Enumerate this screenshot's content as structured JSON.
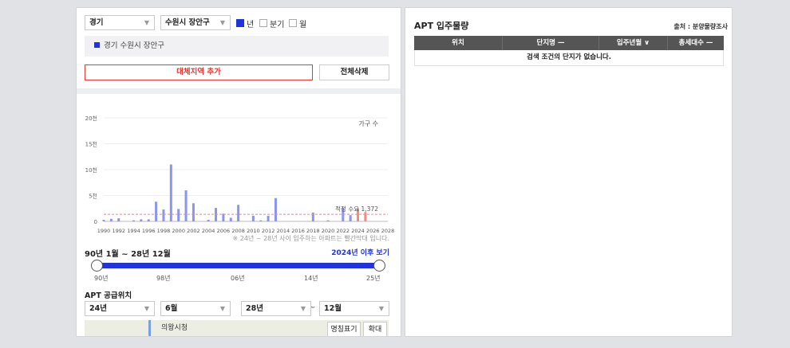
{
  "filters": {
    "province": "경기",
    "district": "수원시 장안구",
    "period_types": [
      {
        "label": "년",
        "checked": true
      },
      {
        "label": "분기",
        "checked": false
      },
      {
        "label": "월",
        "checked": false
      }
    ]
  },
  "selected_region": "경기 수원시 장안구",
  "buttons": {
    "add_region": "대체지역 추가",
    "delete_all": "전체삭제"
  },
  "chart_data": {
    "type": "bar",
    "y_unit_label": "가구 수",
    "ylim": [
      0,
      20000
    ],
    "y_ticks": [
      "0",
      "5천",
      "10천",
      "15천",
      "20천"
    ],
    "x_ticks": [
      "1990",
      "1992",
      "1994",
      "1996",
      "1998",
      "2000",
      "2002",
      "2004",
      "2006",
      "2008",
      "2010",
      "2012",
      "2014",
      "2016",
      "2018",
      "2020",
      "2022",
      "2024",
      "2026",
      "2028"
    ],
    "categories": [
      1990,
      1991,
      1992,
      1993,
      1994,
      1995,
      1996,
      1997,
      1998,
      1999,
      2000,
      2001,
      2002,
      2003,
      2004,
      2005,
      2006,
      2007,
      2008,
      2009,
      2010,
      2011,
      2012,
      2013,
      2014,
      2015,
      2016,
      2017,
      2018,
      2019,
      2020,
      2021,
      2022,
      2023,
      2024,
      2025,
      2026,
      2027,
      2028
    ],
    "values": [
      300,
      500,
      600,
      0,
      200,
      400,
      400,
      3800,
      2300,
      11000,
      2400,
      6000,
      3500,
      0,
      300,
      2600,
      1500,
      700,
      3200,
      0,
      1100,
      200,
      1100,
      4500,
      0,
      0,
      0,
      0,
      1700,
      0,
      200,
      0,
      2600,
      1200,
      2500,
      1800,
      0,
      0,
      0
    ],
    "highlight_from": 2024,
    "reference_line": {
      "label": "적정 수요 1,372",
      "value": 1372
    },
    "note": "※ 24년 ~ 28년 사이 입주하는 아파트는 빨간막대 입니다."
  },
  "range": {
    "label": "90년 1월 ~ 28년 12월",
    "after_link": "2024년 이후 보기",
    "start_fraction": 0,
    "end_fraction": 1,
    "ticks": [
      "90년",
      "98년",
      "06년",
      "14년",
      "25년"
    ]
  },
  "supply": {
    "title": "APT 공급위치",
    "from_year": "24년",
    "from_month": "6월",
    "sep": "~",
    "to_year": "28년",
    "to_month": "12월"
  },
  "map": {
    "place_label": "의왕시청",
    "name_toggle": "명칭표기",
    "zoom": "확대"
  },
  "right": {
    "title": "APT 입주물량",
    "source": "출처 : 분양물량조사",
    "columns": [
      "위치",
      "단지명 —",
      "입주년월 ∨",
      "총세대수 —"
    ],
    "empty_message": "검색 조건의 단지가 없습니다."
  },
  "colors": {
    "accent": "#2233dd",
    "bar": "#8a95ee",
    "highlight_bar": "#f28b82",
    "reference_line": "#f28b82",
    "alert": "#e53935"
  }
}
